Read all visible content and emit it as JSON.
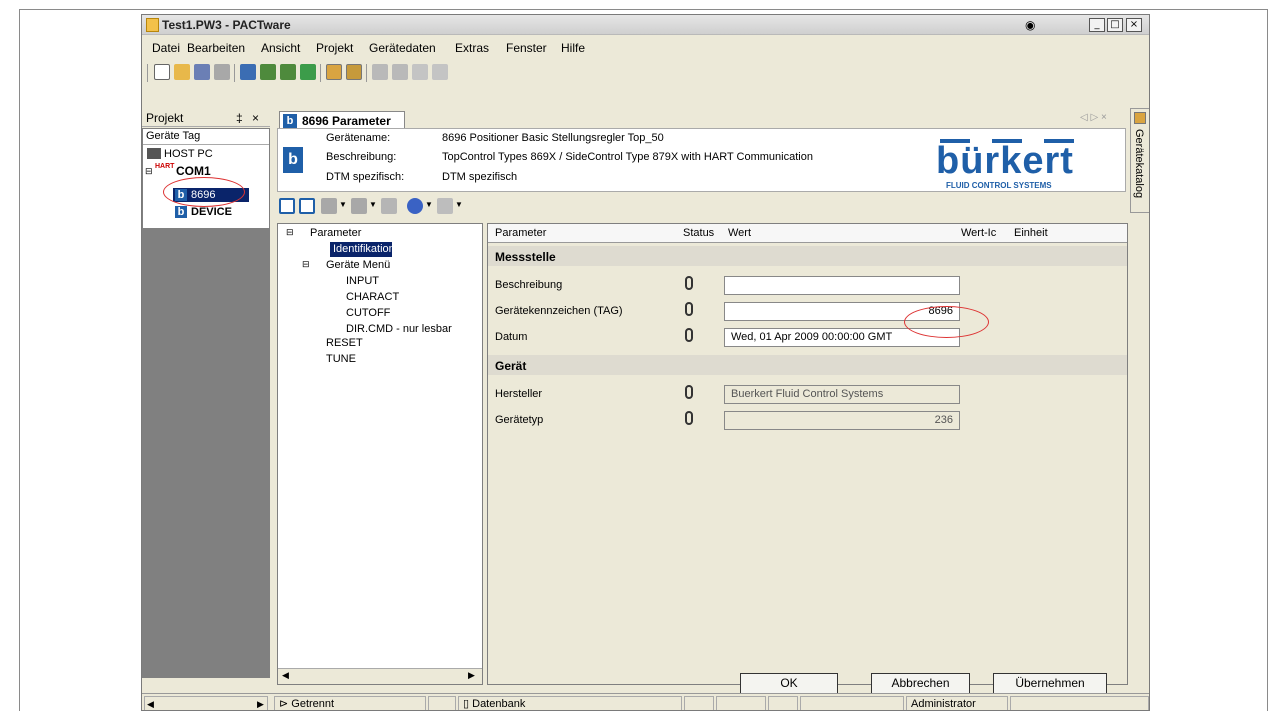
{
  "window": {
    "title": "Test1.PW3 - PACTware"
  },
  "menu": [
    "Datei",
    "Bearbeiten",
    "Ansicht",
    "Projekt",
    "Gerätedaten",
    "Extras",
    "Fenster",
    "Hilfe"
  ],
  "project_panel": {
    "title": "Projekt",
    "pin": "‡",
    "close": "×",
    "column": "Geräte Tag",
    "items": [
      {
        "label": "HOST PC"
      },
      {
        "label": "COM1",
        "badge": "HART"
      },
      {
        "label": "8696"
      },
      {
        "label": "DEVICE"
      }
    ]
  },
  "editor_tab": {
    "label": "8696 Parameter",
    "controls": "◁ ▷ ×"
  },
  "device_header": {
    "name_label": "Gerätename:",
    "name_value": "8696 Positioner Basic Stellungsregler Top_50",
    "desc_label": "Beschreibung:",
    "desc_value": "TopControl Types 869X / SideControl Type 879X  with HART Communication",
    "dtm_label": "DTM spezifisch:",
    "dtm_value": "DTM spezifisch",
    "logo_text": "bürkert",
    "logo_sub": "FLUID CONTROL SYSTEMS"
  },
  "param_tree": {
    "items": [
      {
        "label": "Parameter"
      },
      {
        "label": "Identifikation"
      },
      {
        "label": "Geräte Menü"
      },
      {
        "label": "INPUT"
      },
      {
        "label": "CHARACT"
      },
      {
        "label": "CUTOFF"
      },
      {
        "label": "DIR.CMD - nur lesbar"
      },
      {
        "label": "RESET"
      },
      {
        "label": "TUNE"
      }
    ]
  },
  "grid": {
    "columns": [
      "Parameter",
      "Status",
      "Wert",
      "Wert-Ic",
      "Einheit"
    ],
    "sections": [
      {
        "title": "Messstelle",
        "rows": [
          {
            "param": "Beschreibung",
            "value": ""
          },
          {
            "param": "Gerätekennzeichen (TAG)",
            "value": "8696"
          },
          {
            "param": "Datum",
            "value": "Wed, 01 Apr 2009 00:00:00 GMT"
          }
        ]
      },
      {
        "title": "Gerät",
        "rows": [
          {
            "param": "Hersteller",
            "value": "Buerkert Fluid Control Systems"
          },
          {
            "param": "Gerätetyp",
            "value": "236"
          }
        ]
      }
    ]
  },
  "buttons": {
    "ok": "OK",
    "cancel": "Abbrechen",
    "apply": "Übernehmen"
  },
  "status_bar": {
    "connection": "Getrennt",
    "source": "Datenbank",
    "user": "Administrator"
  },
  "right_strip": {
    "label": "Gerätekatalog"
  },
  "colors": {
    "selection": "#0a246a",
    "highlight_ellipse": "#dd3333",
    "brand_blue": "#1f5fa8"
  }
}
